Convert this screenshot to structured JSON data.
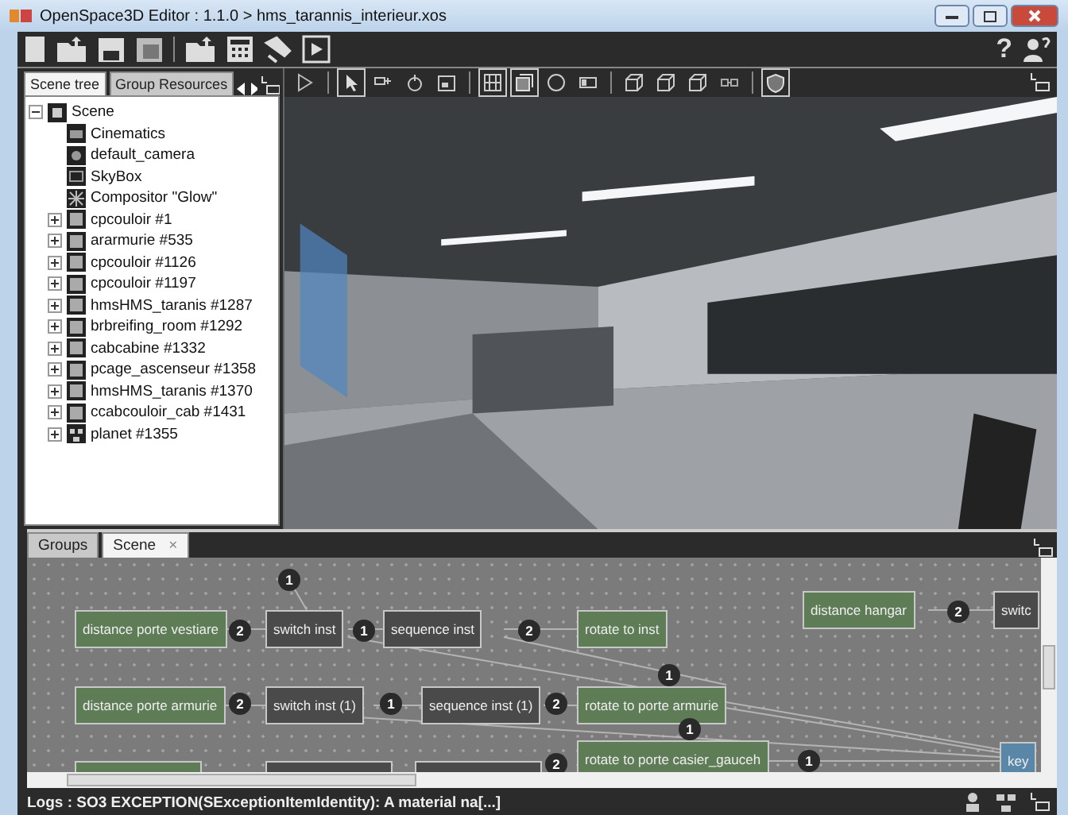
{
  "window": {
    "title": "OpenSpace3D Editor : 1.1.0 > hms_tarannis_interieur.xos"
  },
  "toolbar": {
    "help_label": "?"
  },
  "scene_panel": {
    "tabs": [
      {
        "label": "Scene tree",
        "selected": true
      },
      {
        "label": "Group Resources",
        "selected": false
      }
    ],
    "tree": [
      {
        "label": "Scene",
        "kind": "scene",
        "expanded": true,
        "children": [
          {
            "label": "Cinematics",
            "kind": "cinematics"
          },
          {
            "label": "default_camera",
            "kind": "camera"
          },
          {
            "label": "SkyBox",
            "kind": "skybox"
          },
          {
            "label": "Compositor \"Glow\"",
            "kind": "compositor"
          },
          {
            "label": "cpcouloir #1",
            "kind": "object",
            "expanded": false
          },
          {
            "label": "ararmurie #535",
            "kind": "object",
            "expanded": false
          },
          {
            "label": "cpcouloir #1126",
            "kind": "object",
            "expanded": false
          },
          {
            "label": "cpcouloir #1197",
            "kind": "object",
            "expanded": false
          },
          {
            "label": "hmsHMS_taranis #1287",
            "kind": "object",
            "expanded": false
          },
          {
            "label": "brbreifing_room #1292",
            "kind": "object",
            "expanded": false
          },
          {
            "label": "cabcabine #1332",
            "kind": "object",
            "expanded": false
          },
          {
            "label": "pcage_ascenseur #1358",
            "kind": "object",
            "expanded": false
          },
          {
            "label": "hmsHMS_taranis #1370",
            "kind": "object",
            "expanded": false
          },
          {
            "label": "ccabcouloir_cab #1431",
            "kind": "object",
            "expanded": false
          },
          {
            "label": "planet #1355",
            "kind": "planet",
            "expanded": false
          }
        ]
      }
    ]
  },
  "viewport_tools": [
    {
      "kind": "play",
      "selected": false
    },
    {
      "kind": "separator"
    },
    {
      "kind": "cursor",
      "selected": true
    },
    {
      "kind": "move",
      "selected": false
    },
    {
      "kind": "rotate",
      "selected": false
    },
    {
      "kind": "scale",
      "selected": false
    },
    {
      "kind": "separator"
    },
    {
      "kind": "grid",
      "selected": true
    },
    {
      "kind": "shaded",
      "selected": true
    },
    {
      "kind": "sphere",
      "selected": false
    },
    {
      "kind": "rect",
      "selected": false
    },
    {
      "kind": "separator"
    },
    {
      "kind": "cube",
      "selected": false
    },
    {
      "kind": "cube",
      "selected": false
    },
    {
      "kind": "cube",
      "selected": false
    },
    {
      "kind": "link",
      "selected": false
    },
    {
      "kind": "separator"
    },
    {
      "kind": "shield",
      "selected": true
    }
  ],
  "bottom_panel": {
    "tabs": [
      {
        "label": "Groups",
        "selected": false,
        "closable": false
      },
      {
        "label": "Scene",
        "selected": true,
        "closable": true
      }
    ],
    "close_label": "×",
    "nodes": [
      {
        "label": "distance porte vestiare",
        "kind": "condition"
      },
      {
        "label": "switch inst",
        "kind": "action"
      },
      {
        "label": "sequence inst",
        "kind": "action"
      },
      {
        "label": "rotate to inst",
        "kind": "condition"
      },
      {
        "label": "distance porte armurie",
        "kind": "condition"
      },
      {
        "label": "switch inst (1)",
        "kind": "action"
      },
      {
        "label": "sequence inst (1)",
        "kind": "action"
      },
      {
        "label": "rotate to porte armurie",
        "kind": "condition"
      },
      {
        "label": "rotate to porte casier_gauceh",
        "kind": "condition"
      },
      {
        "label": "distance hangar",
        "kind": "condition"
      },
      {
        "label": "switc",
        "kind": "action"
      },
      {
        "label": "key",
        "kind": "input"
      },
      {
        "kind": "condition"
      },
      {
        "kind": "action"
      },
      {
        "kind": "action"
      }
    ],
    "badges": [
      "1",
      "2",
      "1",
      "2",
      "2",
      "1",
      "2",
      "1",
      "1",
      "2",
      "2",
      "1"
    ]
  },
  "status_bar": {
    "log": "Logs : SO3 EXCEPTION(SExceptionItemIdentity): A material na[...]"
  }
}
